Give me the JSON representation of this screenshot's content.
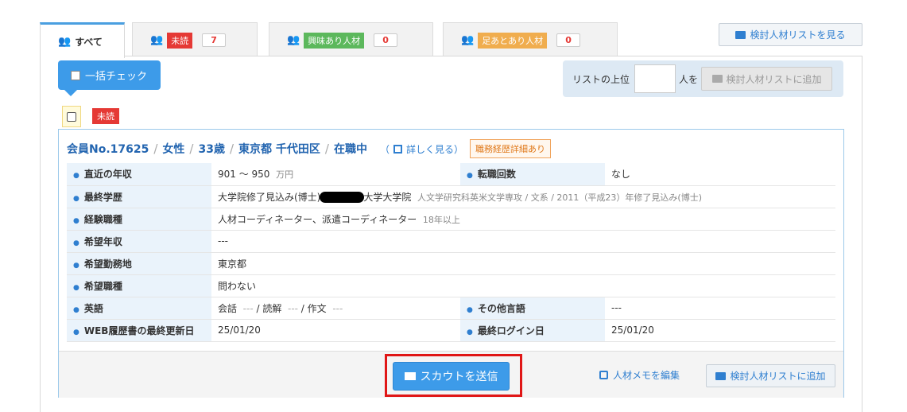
{
  "tabs": [
    {
      "label": "すべて"
    },
    {
      "tag": "未読",
      "count": "7",
      "tag_color": "#e53935"
    },
    {
      "tag": "興味あり人材",
      "count": "0",
      "tag_color": "#5cb85c"
    },
    {
      "tag": "足あとあり人材",
      "count": "0",
      "tag_color": "#f0ad4e"
    }
  ],
  "header": {
    "view_list_button": "検討人材リストを見る"
  },
  "toolbar": {
    "bulk_check_label": "一括チェック",
    "top_prefix": "リストの上位",
    "top_suffix": "人を",
    "add_to_list_button": "検討人材リストに追加",
    "top_input_value": ""
  },
  "candidate": {
    "unread_badge": "未読",
    "member_no": "会員No.17625",
    "gender": "女性",
    "age": "33歳",
    "location": "東京都 千代田区",
    "status": "在職中",
    "detail_link": "詳しく見る",
    "career_badge": "職務経歴詳細あり",
    "rows": {
      "income": {
        "label": "直近の年収",
        "value": "901 ～ 950",
        "unit": "万円"
      },
      "job_changes": {
        "label": "転職回数",
        "value": "なし"
      },
      "education": {
        "label": "最終学歴",
        "value_a": "大学院修了見込み(博士)",
        "value_b": "大学大学院",
        "sub": "人文学研究科英米文学専攻 / 文系 / 2011（平成23）年修了見込み(博士)"
      },
      "experience": {
        "label": "経験職種",
        "value": "人材コーディネーター、派遣コーディネーター",
        "sub": "18年以上"
      },
      "desired_income": {
        "label": "希望年収",
        "value": "---"
      },
      "desired_location": {
        "label": "希望勤務地",
        "value": "東京都"
      },
      "desired_job": {
        "label": "希望職種",
        "value": "問わない"
      },
      "english": {
        "label": "英語",
        "conv_label": "会話",
        "conv": "---",
        "read_label": "読解",
        "read": "---",
        "write_label": "作文",
        "write": "---"
      },
      "other_lang": {
        "label": "その他言語",
        "value": "---"
      },
      "resume_update": {
        "label": "WEB履歴書の最終更新日",
        "value": "25/01/20"
      },
      "last_login": {
        "label": "最終ログイン日",
        "value": "25/01/20"
      }
    },
    "footer": {
      "scout_button": "スカウトを送信",
      "memo_link": "人材メモを編集",
      "add_to_list_button": "検討人材リストに追加"
    }
  }
}
